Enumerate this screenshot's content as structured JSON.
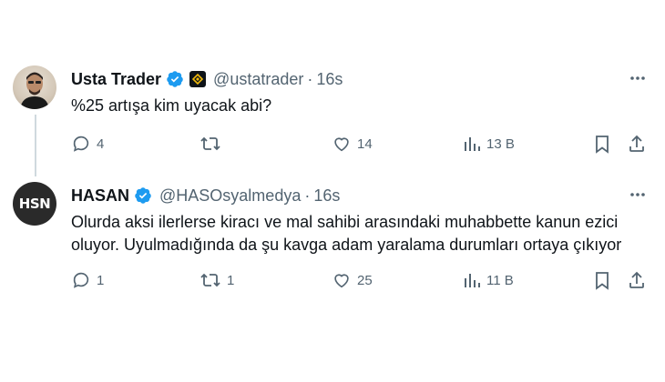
{
  "tweets": [
    {
      "name": "Usta Trader",
      "handle": "@ustatrader",
      "separator": "·",
      "time": "16s",
      "text": "%25 artışa kim uyacak abi?",
      "replies": "4",
      "retweets": "",
      "likes": "14",
      "views": "13 B"
    },
    {
      "name": "HASAN",
      "handle": "@HASOsyalmedya",
      "separator": "·",
      "time": "16s",
      "avatar_text": "HSN",
      "text": "Olurda aksi ilerlerse kiracı ve mal sahibi arasındaki muhabbette kanun ezici oluyor. Uyulmadığında da şu kavga adam yaralama durumları ortaya çıkıyor",
      "replies": "1",
      "retweets": "1",
      "likes": "25",
      "views": "11 B"
    }
  ],
  "colors": {
    "verified": "#1d9bf0",
    "text": "#0f1419",
    "muted": "#536471",
    "thread_line": "#cfd9de"
  },
  "icons": [
    "verified-badge-icon",
    "affiliate-badge-icon",
    "more-icon",
    "reply-icon",
    "retweet-icon",
    "like-icon",
    "views-icon",
    "bookmark-icon",
    "share-icon"
  ]
}
